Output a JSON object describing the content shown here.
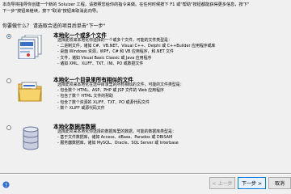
{
  "intro": {
    "line1": "本向导将指导你创建一个新的 Soluizer 工程，请按照您给你的指令来做。在任何时候按下 F1 或\"帮助\"按钮都能获得更多信息，按下\"",
    "line2": "下一步\"按钮来继续，按下\"取消\"按钮来取消此向导。"
  },
  "question": "你要做什么？ 请选取合适的项目后单击\"下一步\"",
  "options": [
    {
      "title": "本地化一个或多个文件",
      "selected": true,
      "lines": [
        "选择此项来本地化你选择的一个或多个文件，可能的文件类型是：",
        "- 二进制文件，诸如 C#、VB.NET、Visual C++、Delphi 或 C++Builder 应用程序或库",
        "- 桌面 Windows 资源，WPF，C# 和 VB 应用程序，和.NET 文件",
        "- 文件，诸如 Visual Basic Classic 或 Java 应用程序",
        "- 诸如 XML、XLIFF、TXT、INI、PO 或数据文件"
      ]
    },
    {
      "title": "本地化一个目录里所有相似的文件",
      "selected": false,
      "lines": [
        "选择此项来本地化在选中目录里的所有相似的文件，可能的文件类型是：",
        "- 包含数个 HTML、ASP、PHP 或 JSP 文件的 Web 应用程序",
        "- 包含了数个 HTML 文件的帮助",
        "- 包含了数个资源的 XLIFF、TXT、PO 或源代码文件",
        "- 数个 XLIFF 或源代码文件"
      ]
    },
    {
      "title": "本地化数据库数据",
      "selected": false,
      "lines": [
        "选择此项来本地化你选择的数据库里的数据，可能的数据库类型是：",
        "- 基于文件数据库，诸如 Access、dBase、Paradox 或 DBISAM",
        "- 服务器数据库，诸如 MySQL、Oracle、SQL Server 或 Interbase"
      ]
    }
  ],
  "buttons": {
    "prev": "< 上一步",
    "next": "下一步 >",
    "cancel": "取消"
  },
  "icons": {
    "help": "help-icon",
    "files": "files-icon",
    "folder": "folder-icon",
    "database": "database-icon"
  }
}
